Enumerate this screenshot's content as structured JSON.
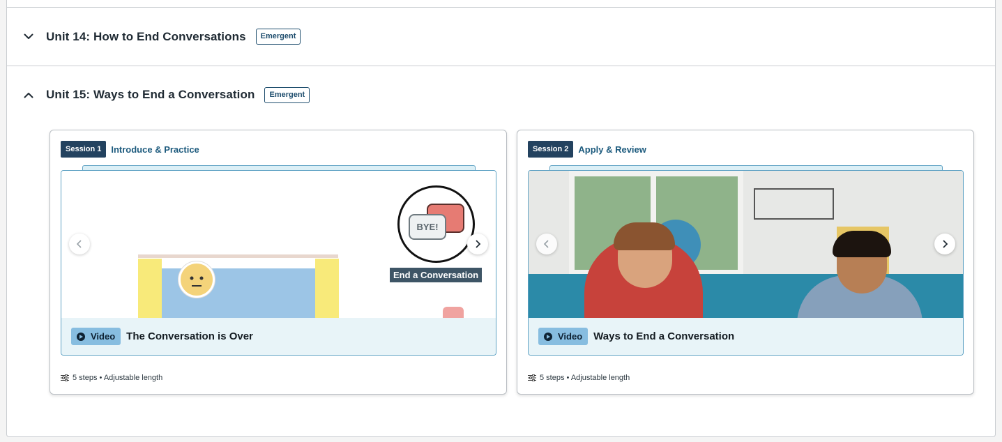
{
  "units": [
    {
      "title": "Unit 14: How to End Conversations",
      "badge": "Emergent",
      "expanded": false
    },
    {
      "title": "Unit 15: Ways to End a Conversation",
      "badge": "Emergent",
      "expanded": true
    }
  ],
  "sessions": [
    {
      "tag": "Session 1",
      "name": "Introduce & Practice",
      "media_type": "Video",
      "media_title": "The Conversation is Over",
      "thumb_text_bubble": "BYE!",
      "thumb_text_label": "End a Conversation",
      "meta": "5 steps • Adjustable length"
    },
    {
      "tag": "Session 2",
      "name": "Apply & Review",
      "media_type": "Video",
      "media_title": "Ways to End a Conversation",
      "meta": "5 steps • Adjustable length"
    }
  ],
  "icons": {
    "collapse": "chevron-down-icon",
    "expand": "chevron-up-icon",
    "prev": "chevron-left-icon",
    "next": "chevron-right-icon",
    "play": "play-icon",
    "steps": "sliders-icon"
  },
  "colors": {
    "session_tag": "#23425f",
    "session_name": "#1c5a7d",
    "video_tag": "#87bde0",
    "caption_bg": "#e8f4f8",
    "media_border": "#5fa2c4"
  }
}
